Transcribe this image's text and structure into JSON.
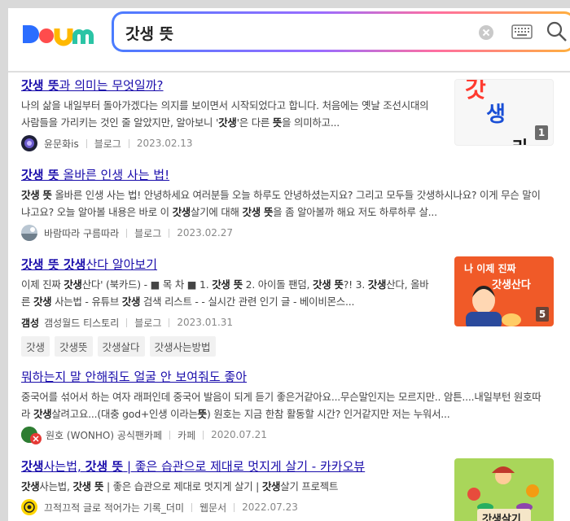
{
  "search": {
    "query": "갓생 뜻"
  },
  "colors": {
    "title": "#1a0dab",
    "logo_d": "#2b6dff",
    "logo_a": "#ff4c4c",
    "logo_u": "#ffb800",
    "logo_m": "#2bc4a5"
  },
  "logo_text": "Daum",
  "results": [
    {
      "title_hl": "갓생 뜻",
      "title_rest": "과 의미는 무엇일까?",
      "desc_pre": "나의 삶을 내일부터 돌아가겠다는 의지를 보이면서 시작되었다고 합니다. 처음에는 옛날 조선시대의 사람들을 가리키는 것인 줄 알았지만, 알아보니 '",
      "desc_b1": "갓생",
      "desc_mid": "'은 다른 ",
      "desc_b2": "뜻",
      "desc_post": "을 의미하고...",
      "author": "윤문화is",
      "category": "블로그",
      "date": "2023.02.13",
      "thumb_count": "1",
      "thumb_chars": [
        "갓",
        "생",
        "라"
      ]
    },
    {
      "title_hl": "갓생 뜻",
      "title_rest": " 올바른 인생 사는 법!",
      "desc_b1": "갓생 뜻",
      "desc_a": " 올바른 인생 사는 법!  안녕하세요 여러분들 오늘 하루도 안녕하셨는지요? 그리고 모두들 갓생하시나요? 이게 무슨 말이냐고요? 오늘 알아볼 내용은 바로 이 ",
      "desc_b2": "갓생",
      "desc_c": "살기에 대해 ",
      "desc_b3": "갓생 뜻",
      "desc_d": "을 좀 알아볼까 해요 저도 하루하루 살...",
      "author": "바람따라 구름따라",
      "category": "블로그",
      "date": "2023.02.27"
    },
    {
      "title_hl": "갓생 뜻 갓생",
      "title_rest": "산다 알아보기",
      "desc_a": "이제 진짜 ",
      "desc_b1": "갓생",
      "desc_b": "산다' (북카드) - ■ 목 차 ■ 1. ",
      "desc_b2": "갓생 뜻",
      "desc_c": " 2. 아이돌 팬덤, ",
      "desc_b3": "갓생 뜻",
      "desc_d": "?! 3. ",
      "desc_b4": "갓생",
      "desc_e": "산다, 올바른 ",
      "desc_b5": "갓생",
      "desc_f": " 사는법 - 유튜브 ",
      "desc_b6": "갓생",
      "desc_g": " 검색 리스트 - - 실시간 관련 인기 글 - 베이비몬스...",
      "author_logo": "갬성",
      "author": "갬성월드 티스토리",
      "category": "블로그",
      "date": "2023.01.31",
      "tags": [
        "갓생",
        "갓생뜻",
        "갓생살다",
        "갓생사는방법"
      ],
      "thumb_count": "5",
      "thumb_line1": "나 이제 진짜",
      "thumb_line2": "갓생산다"
    },
    {
      "title": "뭐하는지 말 안해줘도 얼굴 안 보여줘도 좋아",
      "desc_a": "중국어를 섞어서 하는 여자 래퍼인데 중국어 발음이 되게 듣기 좋은거같아요...무슨말인지는 모르지만.. 암튼....내일부턴 원호따라 ",
      "desc_b1": "갓생",
      "desc_b": "살려고요...(대충 god+인생 이라는",
      "desc_b2": "뜻",
      "desc_c": ") 원호는 지금 한참 활동할 시간? 인거같지만 저는 누워서...",
      "author": "원호 (WONHO) 공식팬카페",
      "category": "카페",
      "date": "2020.07.21"
    },
    {
      "title_hl1": "갓생",
      "title_mid": "사는법, ",
      "title_hl2": "갓생 뜻",
      "title_rest": " | 좋은 습관으로 제대로 멋지게 살기 - 카카오뷰",
      "desc_b1": "갓생",
      "desc_a": "사는법, ",
      "desc_b2": "갓생 뜻",
      "desc_b": " | 좋은 습관으로 제대로 멋지게 살기 | ",
      "desc_b3": "갓생",
      "desc_c": "살기 프로젝트",
      "author": "끄적끄적 글로 적어가는 기록_더미",
      "category": "웹문서",
      "date": "2022.07.23",
      "thumb_text": "갓생살기"
    }
  ]
}
